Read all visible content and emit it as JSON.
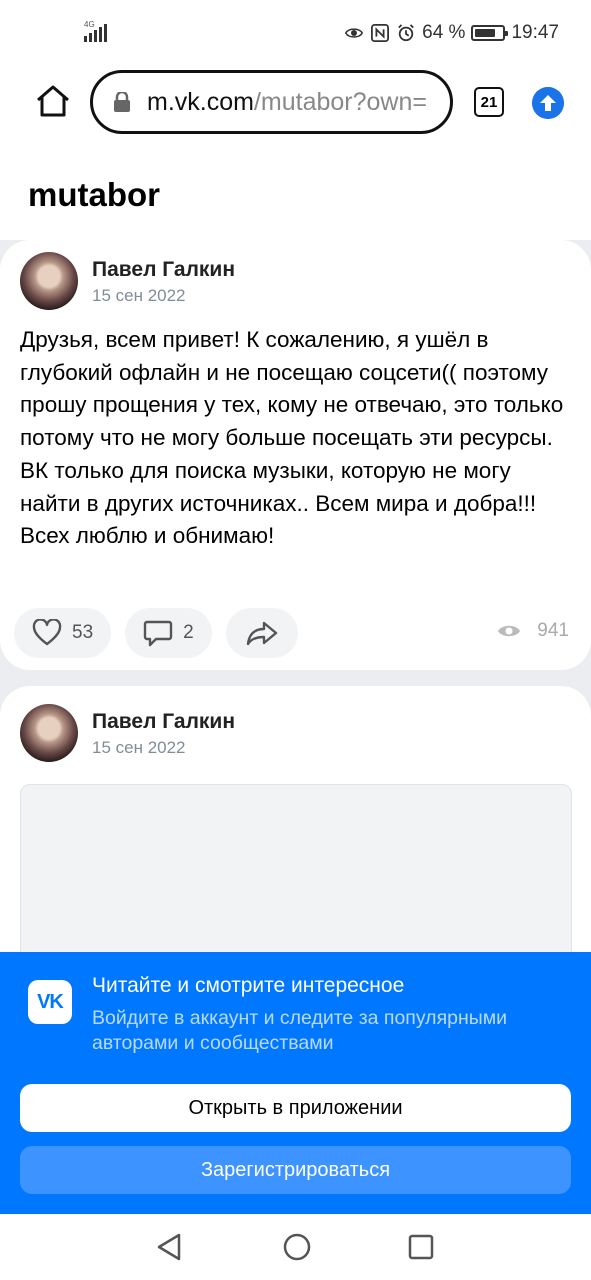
{
  "status_bar": {
    "network_type": "4G",
    "battery_percent": "64 %",
    "battery_level": 0.64,
    "time": "19:47",
    "icons": [
      "eye-icon",
      "nfc-icon",
      "alarm-icon",
      "battery-icon",
      "signal-icon"
    ]
  },
  "browser": {
    "url_domain": "m.vk.com",
    "url_path": "/mutabor?own=",
    "tab_count": "21",
    "icons": [
      "home-icon",
      "lock-icon",
      "tabs-icon",
      "update-icon"
    ]
  },
  "page": {
    "title": "mutabor"
  },
  "posts": [
    {
      "author": "Павел Галкин",
      "date": "15 сен 2022",
      "text": "Друзья, всем привет! К сожалению, я ушёл в глубокий офлайн и не посещаю соцсети(( поэтому прошу прощения у тех, кому не отвечаю, это только потому что не могу больше посещать эти ресурсы. ВК только для поиска музыки, которую не могу найти в других источниках.. Всем мира и добра!!! Всех люблю и обнимаю!",
      "likes": "53",
      "comments": "2",
      "views": "941"
    },
    {
      "author": "Павел Галкин",
      "date": "15 сен 2022"
    }
  ],
  "promo": {
    "logo": "VK",
    "title": "Читайте и смотрите интересное",
    "subtitle": "Войдите в аккаунт и следите за популярными авторами и сообществами",
    "open_button": "Открыть в приложении",
    "register_button": "Зарегистрироваться",
    "colors": {
      "brand": "#0077ff",
      "secondary_button": "#3d93ff"
    }
  },
  "nav": {
    "icons": [
      "back-icon",
      "home-circle-icon",
      "recent-apps-icon"
    ]
  }
}
